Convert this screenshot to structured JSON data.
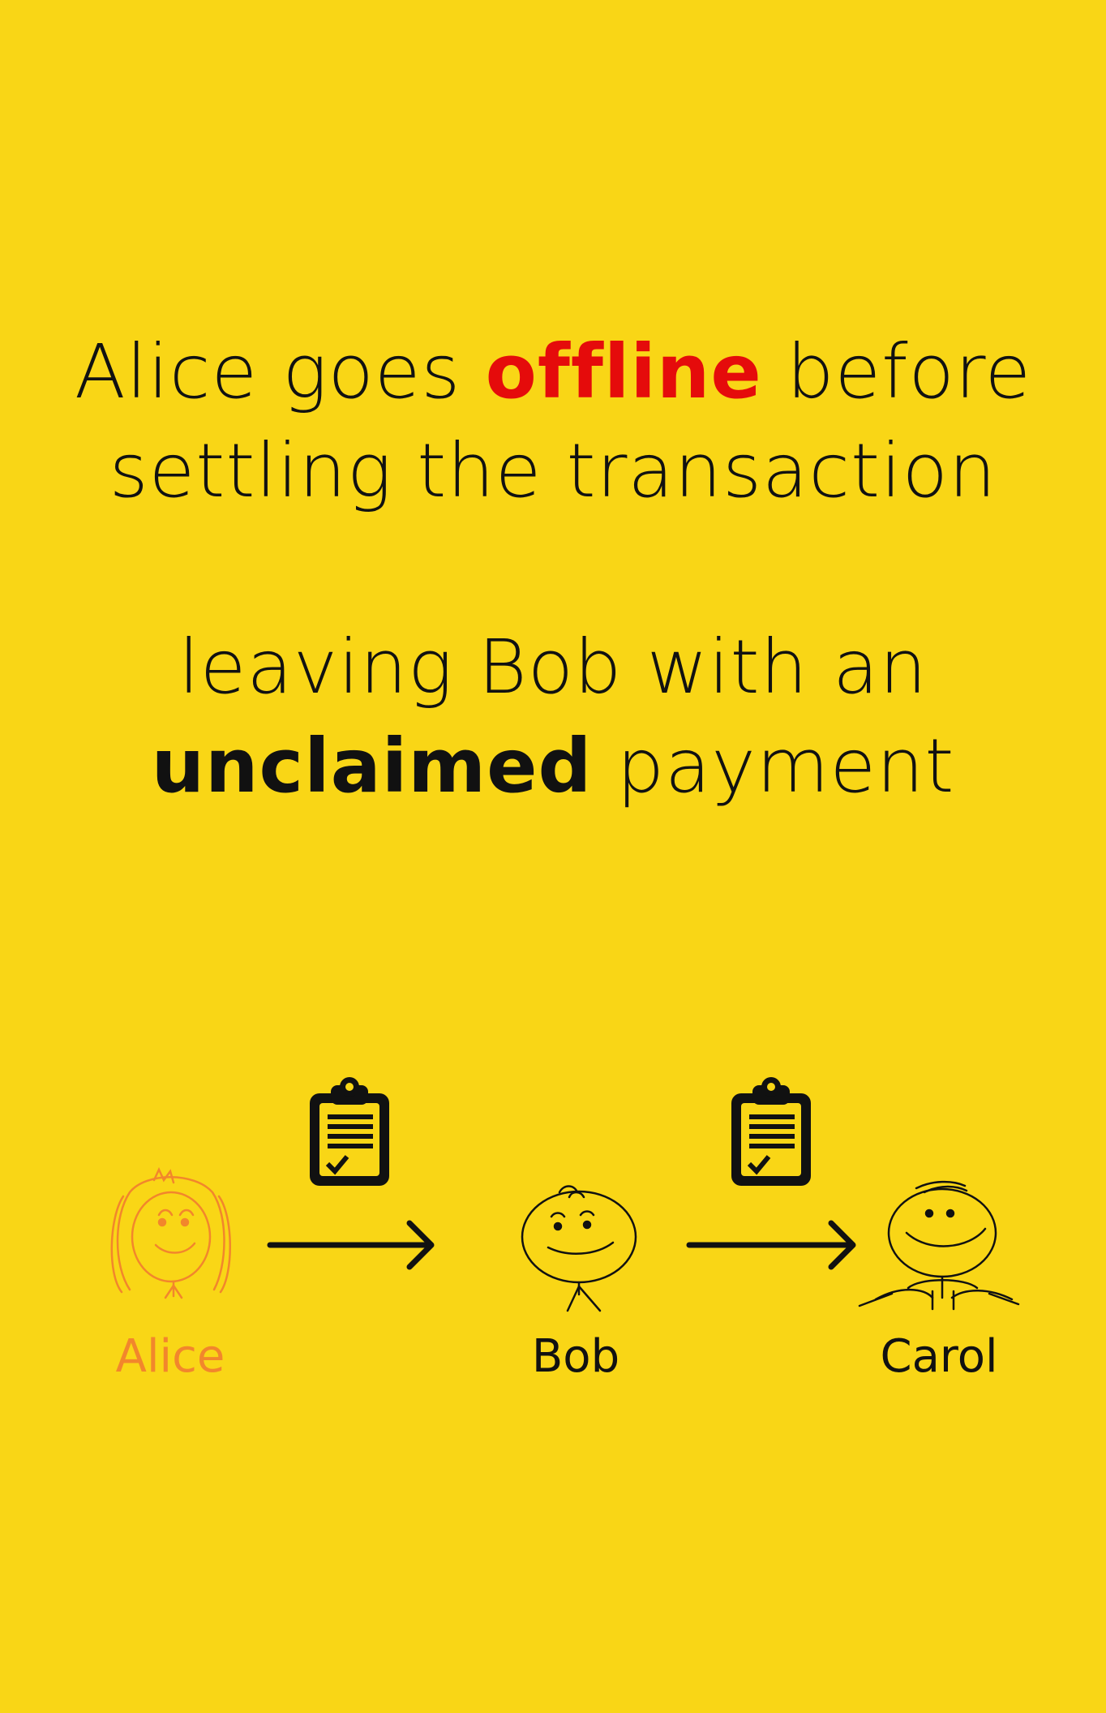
{
  "headline1": {
    "before": "Alice goes ",
    "emphasis": "offline",
    "after": " before",
    "line2": "settling the transaction"
  },
  "headline2": {
    "line1": "leaving Bob with an",
    "emphasis": "unclaimed",
    "after": " payment"
  },
  "people": {
    "alice": "Alice",
    "bob": "Bob",
    "carol": "Carol"
  },
  "colors": {
    "background": "#F9D616",
    "emphasis_red": "#E50B0B",
    "alice_orange": "#F2862C",
    "ink": "#111111"
  },
  "icons": [
    "clipboard-check-icon",
    "arrow-right-icon",
    "stick-figure-icon"
  ]
}
